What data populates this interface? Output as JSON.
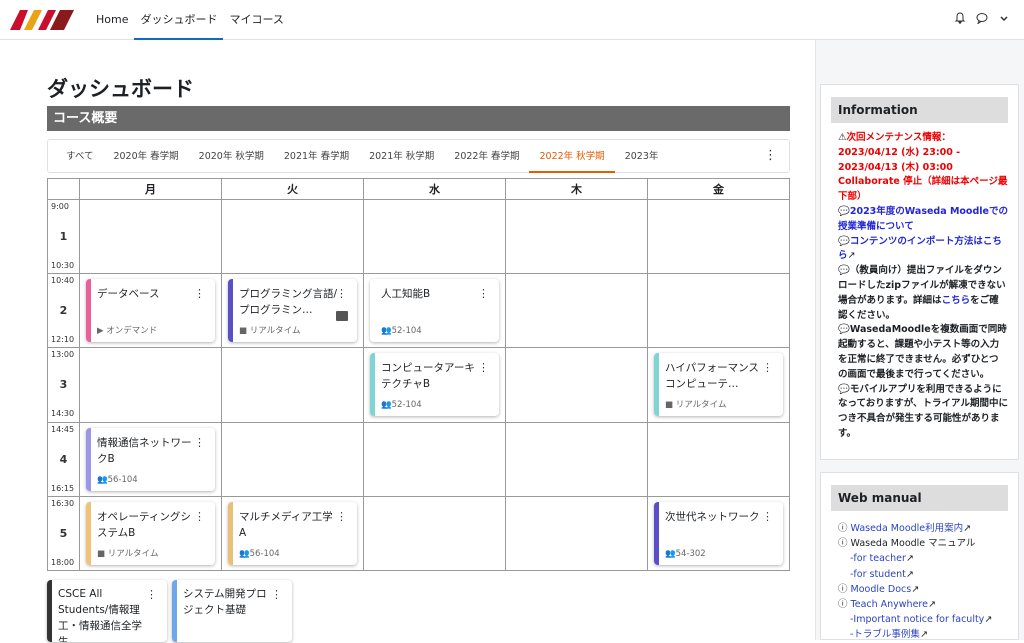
{
  "nav": {
    "items": [
      "Home",
      "ダッシュボード",
      "マイコース"
    ],
    "active": 1
  },
  "topbar": {
    "icons": [
      "bell-icon",
      "chat-icon",
      "chevron-down-icon"
    ]
  },
  "page_title": "ダッシュボード",
  "section_title": "コース概要",
  "tabs": [
    "すべて",
    "2020年 春学期",
    "2020年 秋学期",
    "2021年 春学期",
    "2021年 秋学期",
    "2022年 春学期",
    "2022年 秋学期",
    "2023年"
  ],
  "active_tab": "2022年 秋学期",
  "days": [
    "月",
    "火",
    "水",
    "木",
    "金"
  ],
  "periods": [
    {
      "num": "1",
      "start": "9:00",
      "end": "10:30"
    },
    {
      "num": "2",
      "start": "10:40",
      "end": "12:10"
    },
    {
      "num": "3",
      "start": "13:00",
      "end": "14:30"
    },
    {
      "num": "4",
      "start": "14:45",
      "end": "16:15"
    },
    {
      "num": "5",
      "start": "16:30",
      "end": "18:00"
    }
  ],
  "courses": [
    {
      "name": "データベース",
      "meta": "オンデマンド",
      "icon": "video-icon",
      "color": "#e8619a"
    },
    {
      "name": "プログラミング言語/プログラミン…",
      "meta": "リアルタイム",
      "icon": "camera-icon",
      "color": "#5a4fc9"
    },
    {
      "name": "人工知能B",
      "meta": "52-104",
      "icon": "users-icon",
      "color": "#ffffff"
    },
    {
      "name": "コンピュータアーキテクチャB",
      "meta": "52-104",
      "icon": "users-icon",
      "color": "#7fd4d4"
    },
    {
      "name": "ハイパフォーマンスコンピューテ…",
      "meta": "リアルタイム",
      "icon": "camera-icon",
      "color": "#7fd4d4"
    },
    {
      "name": "情報通信ネットワークB",
      "meta": "56-104",
      "icon": "users-icon",
      "color": "#9b97e6"
    },
    {
      "name": "オペレーティングシステムB",
      "meta": "リアルタイム",
      "icon": "camera-icon",
      "color": "#f0c27a"
    },
    {
      "name": "マルチメディア工学A",
      "meta": "56-104",
      "icon": "users-icon",
      "color": "#e8c07a"
    },
    {
      "name": "次世代ネットワーク",
      "meta": "54-302",
      "icon": "users-icon",
      "color": "#5a4fc9"
    }
  ],
  "extra_courses": [
    {
      "name": "CSCE All Students/情報理工・情報通信全学生",
      "color": "#333333"
    },
    {
      "name": "システム開発プロジェクト基礎",
      "color": "#6fa8e8"
    }
  ],
  "information": {
    "title": "Information",
    "lines": [
      {
        "icon": "warning-icon",
        "parts": [
          {
            "t": "次回メンテナンス情報：",
            "c": "red"
          },
          {
            "t": "2023/04/12 (水) 23:00 - 2023/04/13 (木) 03:00 Collaborate 停止（詳細は本ページ最下部）",
            "c": "red"
          }
        ]
      },
      {
        "icon": "chat-icon",
        "parts": [
          {
            "t": "2023年度のWaseda Moodleでの授業準備について",
            "c": "blue"
          }
        ]
      },
      {
        "icon": "chat-icon",
        "parts": [
          {
            "t": "コンテンツのインポート方法はこちら",
            "c": "blue"
          }
        ]
      },
      {
        "icon": "chat-icon",
        "parts": [
          {
            "t": "（教員向け）提出ファイルをダウンロードしたzipファイルが解凍できない場合があります。詳細は",
            "c": "bold"
          },
          {
            "t": "こちら",
            "c": "blue"
          },
          {
            "t": "をご確認ください。",
            "c": "bold"
          }
        ]
      },
      {
        "icon": "chat-icon",
        "parts": [
          {
            "t": "WasedaMoodleを複数画面で同時起動すると、課題や小テスト等の入力を正常に終了できません。必ずひとつの画面で最後まで行ってください。",
            "c": "bold"
          }
        ]
      },
      {
        "icon": "chat-icon",
        "parts": [
          {
            "t": "モバイルアプリを利用できるようになっておりますが、トライアル期間中につき不具合が発生する可能性があります。",
            "c": "bold"
          }
        ]
      }
    ]
  },
  "web_manual": {
    "title": "Web manual",
    "items": [
      {
        "text": "Waseda Moodle利用案内",
        "link": true,
        "indent": false,
        "q": true
      },
      {
        "text": "Waseda Moodle マニュアル",
        "link": false,
        "indent": false,
        "q": true
      },
      {
        "text": "-for teacher",
        "link": true,
        "indent": true,
        "q": false
      },
      {
        "text": "-for student",
        "link": true,
        "indent": true,
        "q": false
      },
      {
        "text": "Moodle Docs",
        "link": true,
        "indent": false,
        "q": true
      },
      {
        "text": "Teach Anywhere",
        "link": true,
        "indent": false,
        "q": true
      },
      {
        "text": "-Important notice for faculty",
        "link": true,
        "indent": true,
        "q": false
      },
      {
        "text": "-トラブル事例集",
        "link": true,
        "indent": true,
        "q": false
      }
    ]
  }
}
